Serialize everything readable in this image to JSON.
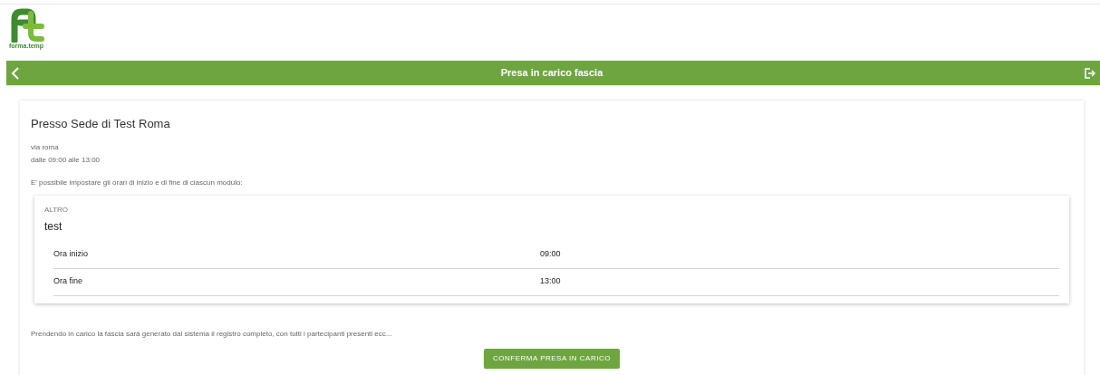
{
  "logo": {
    "text": "forma.temp"
  },
  "header": {
    "title": "Presa in carico fascia"
  },
  "venue": {
    "title": "Presso Sede di Test Roma",
    "address": "via roma",
    "hours": "dalle 09:00 alle 13:00",
    "intro": "E' possibile impostare gli orari di inizio e di fine di ciascun modulo:"
  },
  "module": {
    "category": "ALTRO",
    "name": "test",
    "rows": [
      {
        "label": "Ora inizio",
        "value": "09:00"
      },
      {
        "label": "Ora fine",
        "value": "13:00"
      }
    ]
  },
  "note": "Prendendo in carico la fascia sarà generato dal sistema il registro completo, con tutti i partecipanti presenti ecc...",
  "confirm_button": "CONFERMA PRESA IN CARICO"
}
